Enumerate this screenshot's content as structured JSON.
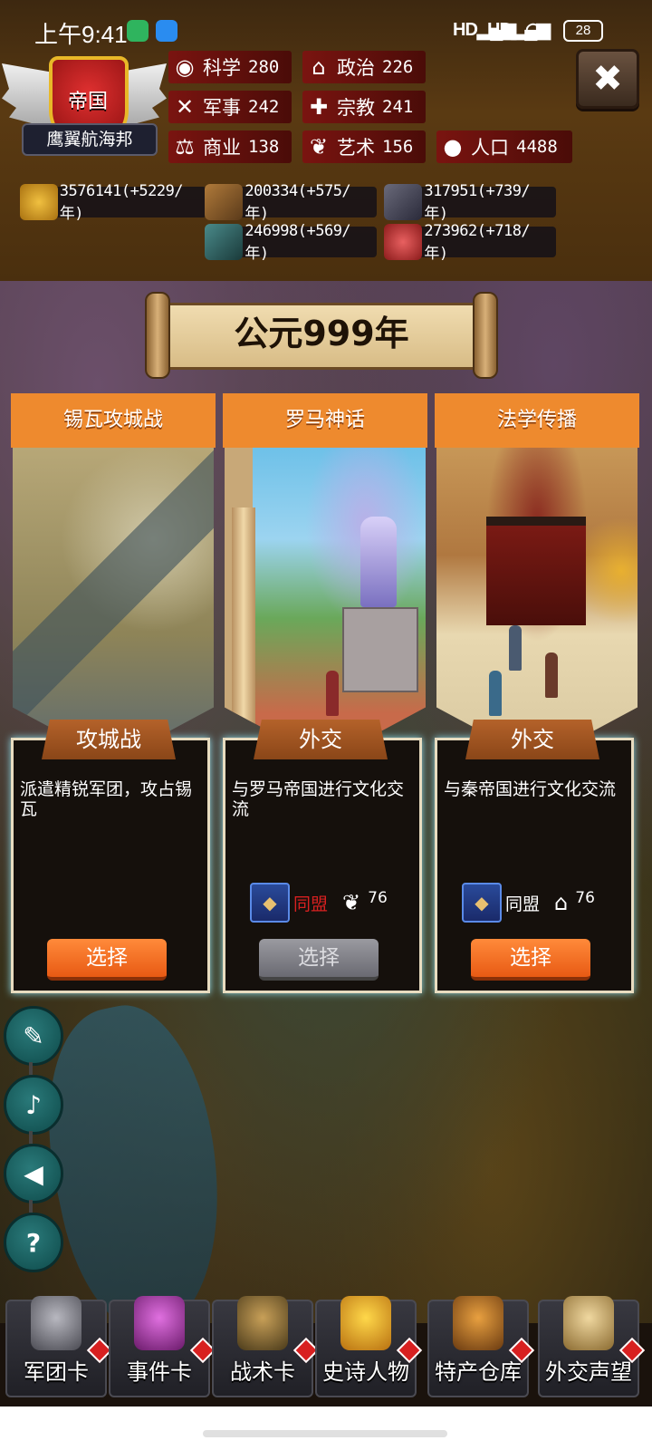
{
  "status_bar": {
    "time": "上午9:41",
    "signal1": "HD",
    "signal2": "HD",
    "battery": "28"
  },
  "emblem": {
    "title": "帝国",
    "name": "鹰翼航海邦"
  },
  "stats": [
    {
      "key": "science",
      "icon": "planet-icon",
      "label": "科学",
      "value": "280"
    },
    {
      "key": "politics",
      "icon": "temple-icon",
      "label": "政治",
      "value": "226"
    },
    {
      "key": "military",
      "icon": "crossed-swords-icon",
      "label": "军事",
      "value": "242"
    },
    {
      "key": "religion",
      "icon": "cross-icon",
      "label": "宗教",
      "value": "241"
    },
    {
      "key": "commerce",
      "icon": "scales-icon",
      "label": "商业",
      "value": "138"
    },
    {
      "key": "art",
      "icon": "laurel-icon",
      "label": "艺术",
      "value": "156"
    },
    {
      "key": "population",
      "icon": "person-icon",
      "label": "人口",
      "value": "4488"
    }
  ],
  "resources": [
    {
      "icon": "gold-coins-icon",
      "text": "3576141(+5229/年)",
      "color": "#d8a020"
    },
    {
      "icon": "wood-logs-icon",
      "text": "200334(+575/年)",
      "color": "#8a5a2a"
    },
    {
      "icon": "stone-icon",
      "text": "317951(+739/年)",
      "color": "#5a5a6a"
    },
    {
      "icon": "iron-ore-icon",
      "text": "246998(+569/年)",
      "color": "#3a6a6a"
    },
    {
      "icon": "meat-icon",
      "text": "273962(+718/年)",
      "color": "#b83a3a"
    }
  ],
  "year_banner": "公元999年",
  "cards": [
    {
      "title": "锡瓦攻城战",
      "type": "攻城战",
      "description": "派遣精锐军团，攻占锡瓦",
      "button": "选择",
      "enabled": true,
      "requirement": null
    },
    {
      "title": "罗马神话",
      "type": "外交",
      "description": "与罗马帝国进行文化交流",
      "button": "选择",
      "enabled": false,
      "requirement": {
        "relation": "同盟",
        "relation_color": "#d82020",
        "stat_icon": "laurel-icon",
        "value": "76"
      }
    },
    {
      "title": "法学传播",
      "type": "外交",
      "description": "与秦帝国进行文化交流",
      "button": "选择",
      "enabled": true,
      "requirement": {
        "relation": "同盟",
        "relation_color": "#ffffff",
        "stat_icon": "temple-icon",
        "value": "76"
      }
    }
  ],
  "side_controls": [
    {
      "name": "log-button",
      "icon": "book-quill-icon"
    },
    {
      "name": "music-button",
      "icon": "music-note-icon"
    },
    {
      "name": "sound-button",
      "icon": "speaker-icon"
    },
    {
      "name": "help-button",
      "icon": "question-icon"
    }
  ],
  "dock": [
    {
      "label": "军团卡",
      "icon": "helmet-icon",
      "color": "#8a8a92"
    },
    {
      "label": "事件卡",
      "icon": "scroll-icon",
      "color": "#a83aa8"
    },
    {
      "label": "战术卡",
      "icon": "shield-swords-icon",
      "color": "#6a5a3a"
    },
    {
      "label": "史诗人物",
      "icon": "crown-icon",
      "color": "#e8b020"
    },
    {
      "label": "特产仓库",
      "icon": "chest-icon",
      "color": "#a86a20"
    },
    {
      "label": "外交声望",
      "icon": "envelope-icon",
      "color": "#c8a860"
    }
  ]
}
